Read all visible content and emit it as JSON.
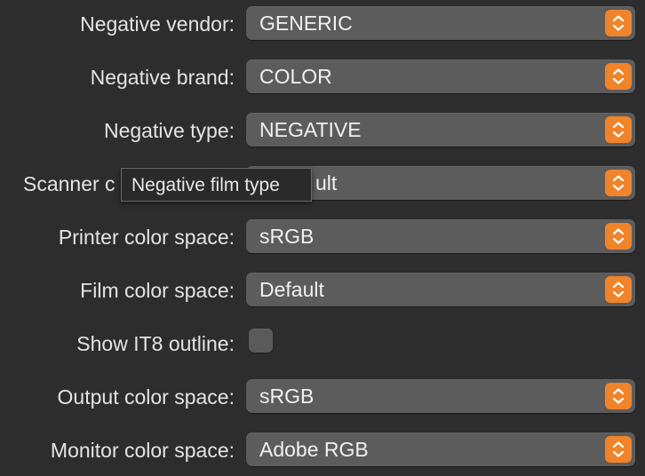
{
  "settings": [
    {
      "label": "Negative vendor:",
      "control": "popup",
      "value": "GENERIC"
    },
    {
      "label": "Negative brand:",
      "control": "popup",
      "value": "COLOR"
    },
    {
      "label": "Negative type:",
      "control": "popup",
      "value": "NEGATIVE"
    },
    {
      "label": "Scanner c",
      "control": "popup",
      "value": "ult"
    },
    {
      "label": "Printer color space:",
      "control": "popup",
      "value": "sRGB"
    },
    {
      "label": "Film color space:",
      "control": "popup",
      "value": "Default"
    },
    {
      "label": "Show IT8 outline:",
      "control": "checkbox",
      "checked": false
    },
    {
      "label": "Output color space:",
      "control": "popup",
      "value": "sRGB"
    },
    {
      "label": "Monitor color space:",
      "control": "popup",
      "value": "Adobe RGB"
    }
  ],
  "tooltip": {
    "text": "Negative film type"
  },
  "colors": {
    "background": "#2d2d2d",
    "popup_bg": "#5c5c5c",
    "accent": "#f0842a",
    "text": "#e6e6e6"
  },
  "icons": {
    "stepper": "chevron-up-down-icon"
  }
}
